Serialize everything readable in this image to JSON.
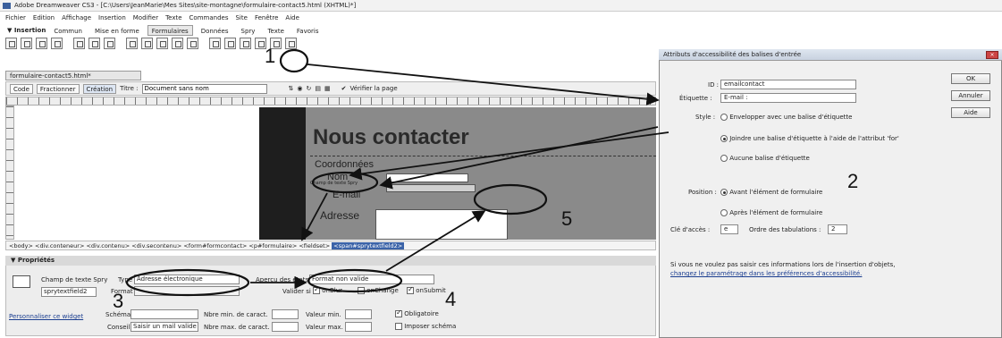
{
  "window": {
    "title": "Adobe Dreamweaver CS3 - [C:\\Users\\JeanMarie\\Mes Sites\\site-montagne\\formulaire-contact5.html (XHTML)*]"
  },
  "menu": [
    "Fichier",
    "Edition",
    "Affichage",
    "Insertion",
    "Modifier",
    "Texte",
    "Commandes",
    "Site",
    "Fenêtre",
    "Aide"
  ],
  "insert_bar": {
    "label": "▼ Insertion",
    "tabs": [
      "Commun",
      "Mise en forme",
      "Formulaires",
      "Données",
      "Spry",
      "Texte",
      "Favoris"
    ],
    "active": "Formulaires"
  },
  "document": {
    "tab": "formulaire-contact5.html*",
    "code_btn": "Code",
    "split_btn": "Fractionner",
    "design_btn": "Création",
    "title_label": "Titre :",
    "title_value": "Document sans nom",
    "validate": "Vérifier la page"
  },
  "page": {
    "heading": "Nous contacter",
    "legend": "Coordonnées",
    "nom": "Nom",
    "spry_tag": "Champ de texte Spry",
    "email": "E-mail",
    "adresse": "Adresse"
  },
  "tag_selector": {
    "path": "<body> <div.conteneur> <div.contenu> <div.secontenu> <form#formcontact> <p#formulaire> <fieldset> ",
    "selected": "<span#sprytextfield2>"
  },
  "properties": {
    "header": "▼ Propriétés",
    "widget_label": "Champ de texte Spry",
    "widget_name": "sprytextfield2",
    "type_label": "Type",
    "type_value": "Adresse électronique",
    "format_label": "Format",
    "preview_label": "Aperçu des états",
    "preview_value": "Format non valide",
    "validate_label": "Valider si",
    "onblur": "onBlur",
    "onchange": "onChange",
    "onsubmit": "onSubmit",
    "customize": "Personnaliser ce widget",
    "schema_label": "Schéma",
    "hint_label": "Conseil",
    "hint_value": "Saisir un mail valide",
    "min_chars": "Nbre min. de caract.",
    "max_chars": "Nbre max. de caract.",
    "min_val": "Valeur min.",
    "max_val": "Valeur max.",
    "required": "Obligatoire",
    "enforce": "Imposer schéma"
  },
  "dialog": {
    "title": "Attributs d'accessibilité des balises d'entrée",
    "id_label": "ID :",
    "id_value": "emailcontact",
    "label_label": "Étiquette :",
    "label_value": "E-mail :",
    "style_label": "Style :",
    "style_opt1": "Envelopper avec une balise d'étiquette",
    "style_opt2": "Joindre une balise d'étiquette à l'aide de l'attribut 'for'",
    "style_opt3": "Aucune balise d'étiquette",
    "position_label": "Position :",
    "pos_opt1": "Avant l'élément de formulaire",
    "pos_opt2": "Après l'élément de formulaire",
    "access_key_label": "Clé d'accès :",
    "access_key_value": "e",
    "tab_order_label": "Ordre des tabulations :",
    "tab_order_value": "2",
    "ok": "OK",
    "cancel": "Annuler",
    "help": "Aide",
    "note1": "Si vous ne voulez pas saisir ces informations lors de l'insertion d'objets,",
    "note2": "changez le paramétrage dans les préférences d'accessibilité."
  },
  "annotations": {
    "n1": "1",
    "n2": "2",
    "n3": "3",
    "n4": "4",
    "n5": "5"
  }
}
